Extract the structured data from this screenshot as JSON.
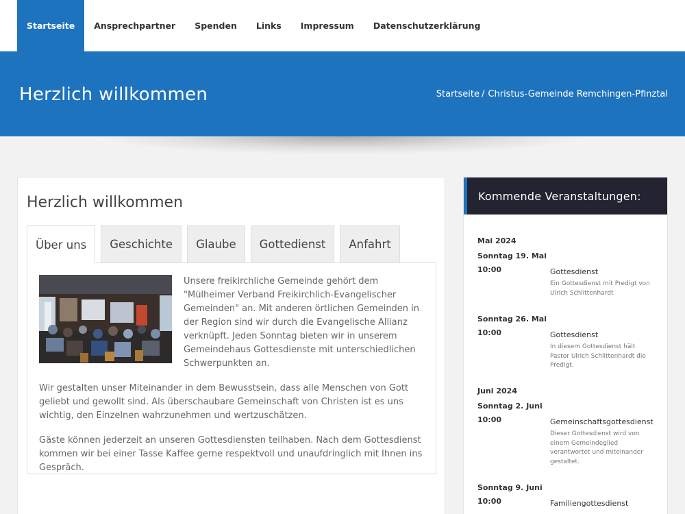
{
  "nav": {
    "items": [
      {
        "label": "Startseite",
        "active": true
      },
      {
        "label": "Ansprechpartner",
        "active": false
      },
      {
        "label": "Spenden",
        "active": false
      },
      {
        "label": "Links",
        "active": false
      },
      {
        "label": "Impressum",
        "active": false
      },
      {
        "label": "Datenschutzerklärung",
        "active": false
      }
    ]
  },
  "hero": {
    "title": "Herzlich willkommen",
    "breadcrumb": {
      "home": "Startseite",
      "separator": "/",
      "current": "Christus-Gemeinde Remchingen-Pfinztal"
    }
  },
  "main": {
    "title": "Herzlich willkommen",
    "tabs": [
      "Über uns",
      "Geschichte",
      "Glaube",
      "Gottedienst",
      "Anfahrt"
    ],
    "paragraphs": [
      "Unsere freikirchliche Gemeinde gehört dem \"Mülheimer Verband Freikirchlich-Evangelischer Gemeinden\" an. Mit anderen örtlichen Gemeinden in der Region sind wir durch die Evangelische Allianz verknüpft. Jeden Sonntag bieten wir in unserem Gemeindehaus Gottesdienste mit unterschiedlichen Schwerpunkten an.",
      "Wir gestalten unser Miteinander in dem Bewusstsein, dass alle Menschen von Gott geliebt und gewollt sind. Als überschaubare Gemeinschaft von Christen ist es uns wichtig, den Einzelnen wahrzunehmen und wertzuschätzen.",
      "Gäste können jederzeit an unseren Gottesdiensten teilhaben. Nach dem Gottesdienst kommen wir bei einer Tasse Kaffee gerne respektvoll und unaufdringlich mit Ihnen ins Gespräch."
    ]
  },
  "sidebar": {
    "title": "Kommende Veranstaltungen:",
    "months": [
      "Mai 2024",
      "Juni 2024"
    ],
    "events": [
      {
        "day": "Sonntag 19. Mai",
        "time": "10:00",
        "title": "Gottesdienst",
        "desc": "Ein Gottesdienst mit Predigt von Ulrich Schlittenhardt"
      },
      {
        "day": "Sonntag 26. Mai",
        "time": "10:00",
        "title": "Gottesdienst",
        "desc": "In diesem Gottesdienst hält Pastor Ulrich Schlittenhardt die Predigt."
      },
      {
        "day": "Sonntag 2. Juni",
        "time": "10:00",
        "title": "Gemeinschaftsgottesdienst",
        "desc": "Dieser Gottesdienst wird von einem Gemeindeglied verantwortet und miteinander gestaltet."
      },
      {
        "day": "Sonntag 9. Juni",
        "time": "10:00",
        "title": "Familiengottesdienst",
        "desc": ""
      }
    ]
  },
  "colors": {
    "accent": "#1e73be",
    "sidebar_header": "#232331"
  }
}
